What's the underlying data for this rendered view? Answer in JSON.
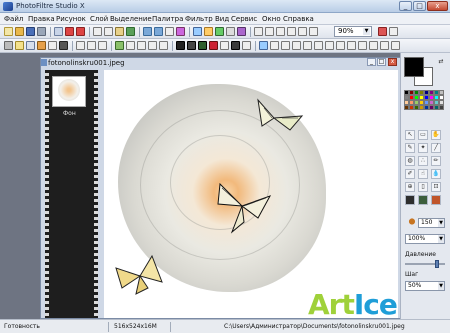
{
  "window": {
    "title": "PhotoFiltre Studio X"
  },
  "menu": [
    "Файл",
    "Правка",
    "Рисунок",
    "Слой",
    "Выделение",
    "Палитра",
    "Фильтр",
    "Вид",
    "Сервис",
    "Окно",
    "Справка"
  ],
  "toolbar": {
    "zoom_value": "90%"
  },
  "document": {
    "title": "fotonolinskru001.jpeg"
  },
  "filmstrip": {
    "layer_label": "Фон"
  },
  "tools": {
    "brush_size": "150",
    "opacity": "100%",
    "pressure_label": "Давление",
    "step_label": "Шаг",
    "step_value": "50%"
  },
  "statusbar": {
    "status": "Готовность",
    "dimensions": "516x524x16M",
    "path": "C:\\Users\\Администратор\\Documents\\fotonolinskru001.jpeg"
  },
  "watermark": {
    "part1": "Art",
    "part2": "Ice"
  },
  "colors": {
    "accent": "#1f9ed8",
    "watermark_green": "#9fd13a",
    "watermark_blue": "#1f9ed8"
  }
}
